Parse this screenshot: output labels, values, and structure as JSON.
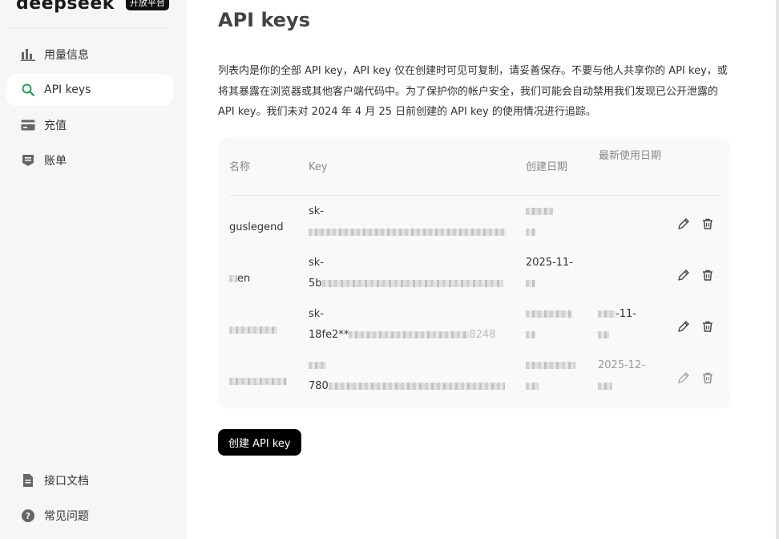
{
  "brand": {
    "logo": "deepseek",
    "badge": "开放平台"
  },
  "sidebar": {
    "items": [
      {
        "label": "用量信息",
        "icon": "bar-chart-icon",
        "active": false
      },
      {
        "label": "API keys",
        "icon": "key-search-icon",
        "active": true
      },
      {
        "label": "充值",
        "icon": "card-icon",
        "active": false
      },
      {
        "label": "账单",
        "icon": "bill-icon",
        "active": false
      }
    ],
    "bottom_items": [
      {
        "label": "接口文档",
        "icon": "document-icon"
      },
      {
        "label": "常见问题",
        "icon": "help-icon"
      }
    ]
  },
  "main": {
    "title": "API keys",
    "intro": "列表内是你的全部 API key，API key 仅在创建时可见可复制，请妥善保存。不要与他人共享你的 API key，或将其暴露在浏览器或其他客户端代码中。为了保护你的帐户安全，我们可能会自动禁用我们发现已公开泄露的 API key。我们未对 2024 年 4 月 25 日前创建的 API key 的使用情况进行追踪。",
    "table": {
      "headers": {
        "name": "名称",
        "key": "Key",
        "created": "创建日期",
        "last_used": "最新使用日期"
      },
      "rows": [
        {
          "name": "guslegend",
          "key_line1": "sk-",
          "key_line2": "",
          "created_line1": "",
          "created_line2": "",
          "last_line1": "",
          "last_line2": ""
        },
        {
          "name": "en",
          "key_line1": "sk-",
          "key_line2": "5b",
          "created_line1": "2025-11-",
          "created_line2": "",
          "last_line1": "",
          "last_line2": ""
        },
        {
          "name": "",
          "key_line1": "sk-",
          "key_line2": "18fe2**",
          "key_tail": "8248",
          "created_line1": "",
          "created_line2": "",
          "last_line1": "-11-",
          "last_line2": ""
        },
        {
          "name": "",
          "key_line1": "",
          "key_line2": "780",
          "created_line1": "",
          "created_line2": "",
          "last_line1": "2025-12-",
          "last_line2": ""
        }
      ]
    },
    "create_button": "创建 API key"
  },
  "colors": {
    "accent": "#22a05a",
    "button_bg": "#000000",
    "sidebar_bg": "#f6f6f7",
    "card_bg": "#f9f9f9"
  }
}
